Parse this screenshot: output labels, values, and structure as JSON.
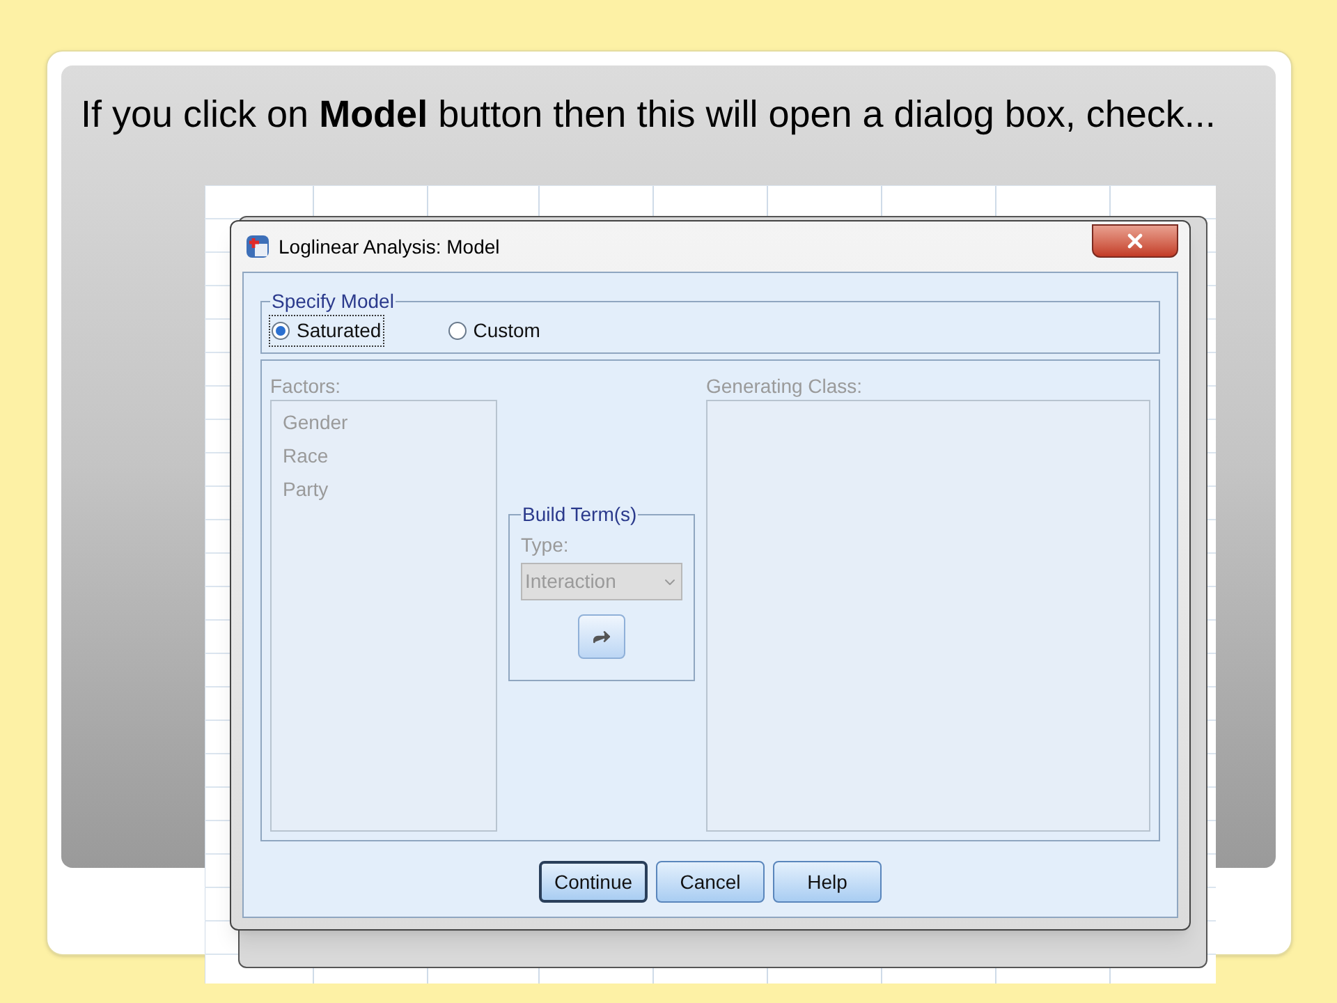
{
  "slide": {
    "heading": "If you click on **Model** button then this will open a dialog box, check..."
  },
  "dialog": {
    "title": "Loglinear Analysis: Model",
    "specify_model": {
      "legend": "Specify Model",
      "options": [
        {
          "label": "Saturated",
          "selected": true
        },
        {
          "label": "Custom",
          "selected": false
        }
      ]
    },
    "terms": {
      "disabled": true,
      "factors_label": "Factors:",
      "factors": [
        "Gender",
        "Race",
        "Party"
      ],
      "build_terms": {
        "legend": "Build Term(s)",
        "type_label": "Type:",
        "type_value": "Interaction"
      },
      "generating_class_label": "Generating Class:"
    },
    "buttons": [
      {
        "label": "Continue",
        "default": true
      },
      {
        "label": "Cancel",
        "default": false
      },
      {
        "label": "Help",
        "default": false
      }
    ]
  }
}
